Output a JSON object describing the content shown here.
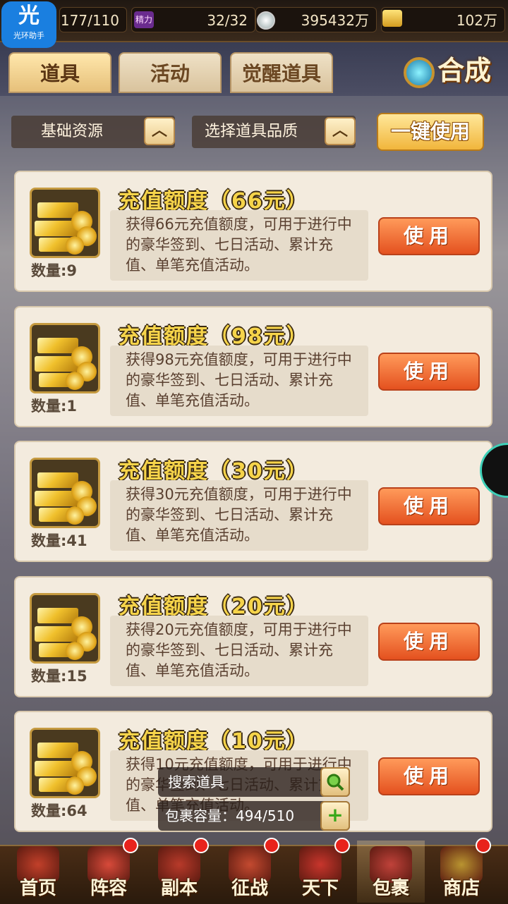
{
  "topbar": {
    "badge_char": "光",
    "badge_label": "光环助手",
    "stamina": "177/110",
    "jingli_icon": "精力",
    "jingli_value": "32/32",
    "silver_value": "395432万",
    "gold_value": "102万"
  },
  "tabs": [
    {
      "label": "道具",
      "active": true
    },
    {
      "label": "活动",
      "active": false
    },
    {
      "label": "觉醒道具",
      "active": false
    }
  ],
  "hecheng_label": "合成",
  "filters": {
    "category": "基础资源",
    "quality": "选择道具品质",
    "one_key_use": "一键使用"
  },
  "items": [
    {
      "title": "充值额度（66元）",
      "qty_label": "数量:9",
      "desc": "获得66元充值额度，可用于进行中的豪华签到、七日活动、累计充值、单笔充值活动。",
      "use": "使用"
    },
    {
      "title": "充值额度（98元）",
      "qty_label": "数量:1",
      "desc": "获得98元充值额度，可用于进行中的豪华签到、七日活动、累计充值、单笔充值活动。",
      "use": "使用"
    },
    {
      "title": "充值额度（30元）",
      "qty_label": "数量:41",
      "desc": "获得30元充值额度，可用于进行中的豪华签到、七日活动、累计充值、单笔充值活动。",
      "use": "使用"
    },
    {
      "title": "充值额度（20元）",
      "qty_label": "数量:15",
      "desc": "获得20元充值额度，可用于进行中的豪华签到、七日活动、累计充值、单笔充值活动。",
      "use": "使用"
    },
    {
      "title": "充值额度（10元）",
      "qty_label": "数量:64",
      "desc": "获得10元充值额度，可用于进行中的豪华签到、七日活动、累计充值、单笔充值活动。",
      "use": "使用"
    }
  ],
  "search": {
    "label": "搜索道具"
  },
  "capacity": {
    "label": "包裹容量：494/510"
  },
  "nav": [
    {
      "label": "首页",
      "dot": false,
      "active": false
    },
    {
      "label": "阵容",
      "dot": true,
      "active": false
    },
    {
      "label": "副本",
      "dot": true,
      "active": false
    },
    {
      "label": "征战",
      "dot": true,
      "active": false
    },
    {
      "label": "天下",
      "dot": true,
      "active": false
    },
    {
      "label": "包裹",
      "dot": false,
      "active": true
    },
    {
      "label": "商店",
      "dot": true,
      "active": false
    }
  ],
  "colors": {
    "use_button": "#e4511f",
    "title_gold": "#f6d44a",
    "notify_dot": "#e8231c"
  }
}
